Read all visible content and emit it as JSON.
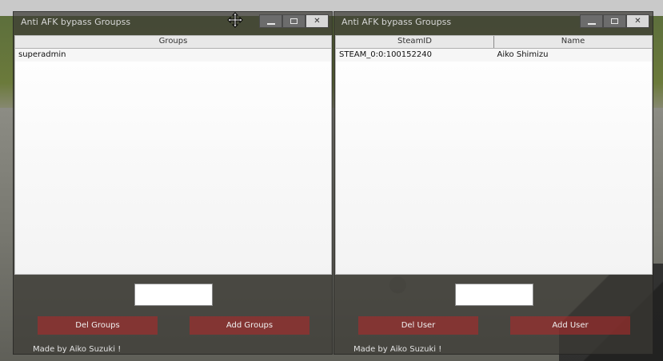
{
  "left_window": {
    "title": "Anti AFK bypass Groupss",
    "columns": [
      "Groups"
    ],
    "rows": [
      [
        "superadmin"
      ]
    ],
    "input_value": "",
    "buttons": {
      "left": "Del Groups",
      "right": "Add Groups"
    },
    "footer": "Made by Aiko Suzuki !"
  },
  "right_window": {
    "title": "Anti AFK bypass Groupss",
    "columns": [
      "SteamID",
      "Name"
    ],
    "rows": [
      [
        "STEAM_0:0:100152240",
        "Aiko Shimizu"
      ]
    ],
    "input_value": "",
    "buttons": {
      "left": "Del User",
      "right": "Add User"
    },
    "footer": "Made by Aiko Suzuki !"
  },
  "window_controls": {
    "minimize": "minimize-icon",
    "maximize": "maximize-icon",
    "close": "close-icon"
  },
  "cursor_icon": "move-cursor-icon"
}
